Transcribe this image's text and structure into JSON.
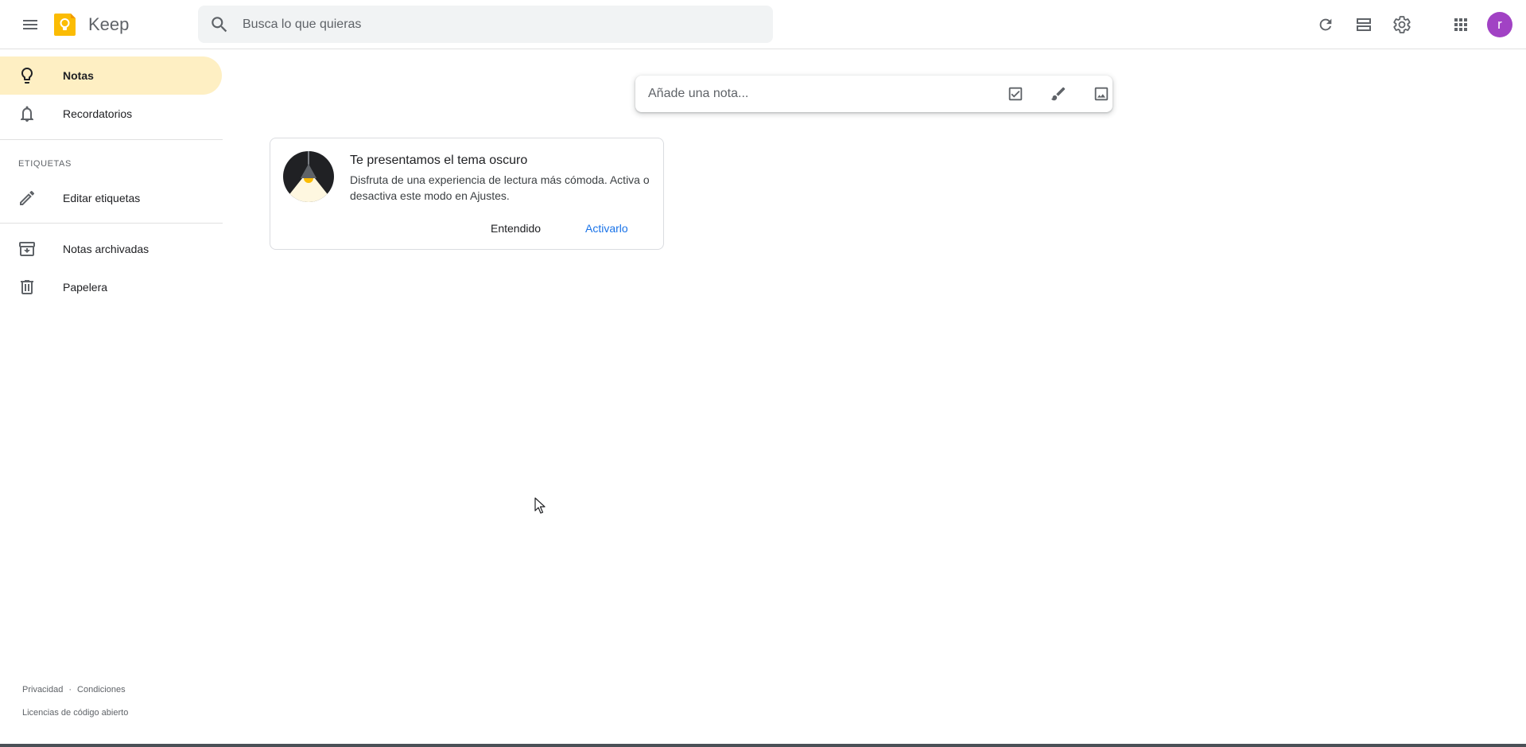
{
  "header": {
    "app_title": "Keep",
    "search_placeholder": "Busca lo que quieras",
    "avatar_letter": "r",
    "avatar_color": "#a142c4",
    "logo_color": "#fbbc04"
  },
  "sidebar": {
    "items": [
      {
        "label": "Notas",
        "icon": "lightbulb-icon",
        "active": true
      },
      {
        "label": "Recordatorios",
        "icon": "bell-icon"
      }
    ],
    "labels_section_title": "ETIQUETAS",
    "edit_labels": {
      "label": "Editar etiquetas",
      "icon": "pencil-icon"
    },
    "archive": {
      "label": "Notas archivadas",
      "icon": "archive-icon"
    },
    "trash": {
      "label": "Papelera",
      "icon": "trash-icon"
    },
    "footer": {
      "privacy": "Privacidad",
      "separator": "·",
      "terms": "Condiciones",
      "open_source": "Licencias de código abierto"
    }
  },
  "composer": {
    "placeholder": "Añade una nota..."
  },
  "promo": {
    "title": "Te presentamos el tema oscuro",
    "body": "Disfruta de una experiencia de lectura más cómoda. Activa o desactiva este modo en Ajustes.",
    "dismiss_label": "Entendido",
    "activate_label": "Activarlo",
    "accent_color": "#1a73e8",
    "active_nav_color": "#feefc3"
  }
}
